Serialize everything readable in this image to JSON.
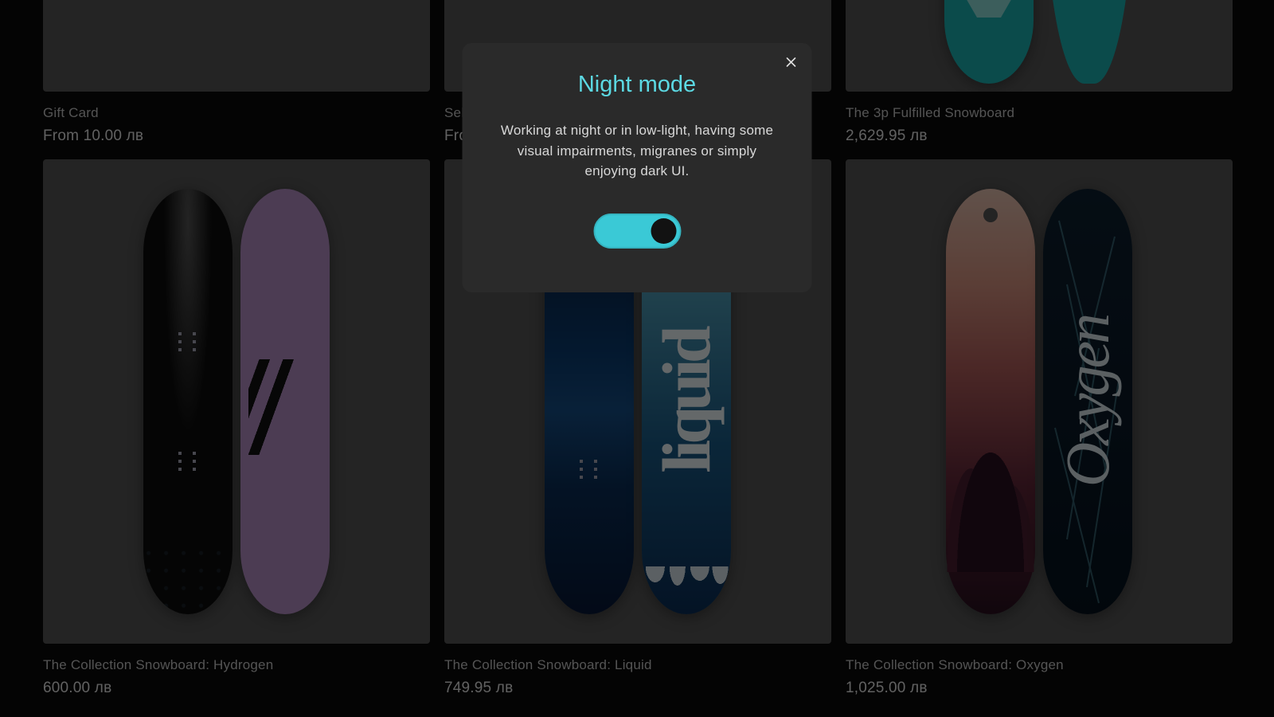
{
  "modal": {
    "title": "Night mode",
    "body": "Working at night or in low-light, having some visual impairments, migranes or simply enjoying dark UI.",
    "enabled": true
  },
  "products": [
    {
      "title": "Gift Card",
      "price": "From 10.00 лв"
    },
    {
      "title": "Sel",
      "price": "Fro"
    },
    {
      "title": "The 3p Fulfilled Snowboard",
      "price": "2,629.95 лв"
    },
    {
      "title": "The Collection Snowboard: Hydrogen",
      "price": "600.00 лв"
    },
    {
      "title": "The Collection Snowboard: Liquid",
      "price": "749.95 лв"
    },
    {
      "title": "The Collection Snowboard: Oxygen",
      "price": "1,025.00 лв"
    }
  ]
}
